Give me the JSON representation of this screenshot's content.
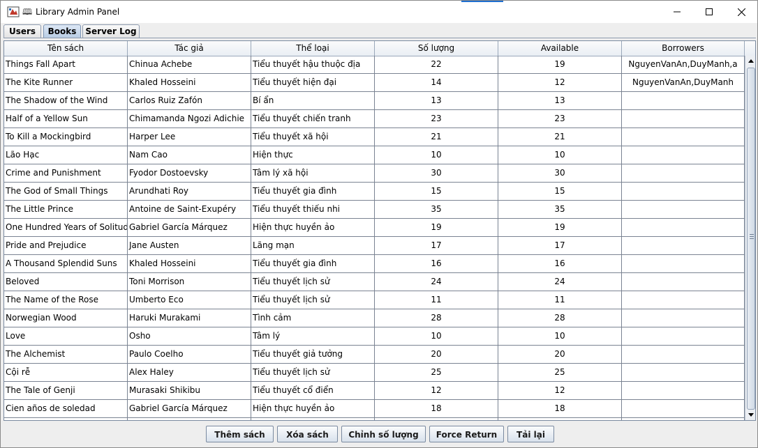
{
  "window": {
    "title": "Library Admin Panel",
    "accent_color": "#1f6fd0"
  },
  "icons": {
    "app": "app-icon",
    "minimize": "minimize-icon",
    "maximize": "maximize-icon",
    "close": "close-icon"
  },
  "tabs": [
    {
      "label": "Users"
    },
    {
      "label": "Books"
    },
    {
      "label": "Server Log"
    }
  ],
  "active_tab": "Books",
  "table": {
    "columns": [
      "Tên sách",
      "Tác giả",
      "Thể loại",
      "Số lượng",
      "Available",
      "Borrowers"
    ],
    "rows": [
      [
        "Things Fall Apart",
        "Chinua Achebe",
        "Tiểu thuyết hậu thuộc địa",
        "22",
        "19",
        "NguyenVanAn,DuyManh,a"
      ],
      [
        "The Kite Runner",
        "Khaled Hosseini",
        "Tiểu thuyết hiện đại",
        "14",
        "12",
        "NguyenVanAn,DuyManh"
      ],
      [
        "The Shadow of the Wind",
        "Carlos Ruiz Zafón",
        "Bí ẩn",
        "13",
        "13",
        ""
      ],
      [
        "Half of a Yellow Sun",
        "Chimamanda Ngozi Adichie",
        "Tiểu thuyết chiến tranh",
        "23",
        "23",
        ""
      ],
      [
        "To Kill a Mockingbird",
        "Harper Lee",
        "Tiểu thuyết xã hội",
        "21",
        "21",
        ""
      ],
      [
        "Lão Hạc",
        "Nam Cao",
        "Hiện thực",
        "10",
        "10",
        ""
      ],
      [
        "Crime and Punishment",
        "Fyodor Dostoevsky",
        "Tâm lý xã hội",
        "30",
        "30",
        ""
      ],
      [
        "The God of Small Things",
        "Arundhati Roy",
        "Tiểu thuyết gia đình",
        "15",
        "15",
        ""
      ],
      [
        "The Little Prince",
        "Antoine de Saint-Exupéry",
        "Tiểu thuyết thiếu nhi",
        "35",
        "35",
        ""
      ],
      [
        "One Hundred Years of Solitude",
        "Gabriel García Márquez",
        "Hiện thực huyền ảo",
        "19",
        "19",
        ""
      ],
      [
        "Pride and Prejudice",
        "Jane Austen",
        "Lãng mạn",
        "17",
        "17",
        ""
      ],
      [
        "A Thousand Splendid Suns",
        "Khaled Hosseini",
        "Tiểu thuyết gia đình",
        "16",
        "16",
        ""
      ],
      [
        "Beloved",
        "Toni Morrison",
        "Tiểu thuyết lịch sử",
        "24",
        "24",
        ""
      ],
      [
        "The Name of the Rose",
        "Umberto Eco",
        "Tiểu thuyết lịch sử",
        "11",
        "11",
        ""
      ],
      [
        "Norwegian Wood",
        "Haruki Murakami",
        "Tình cảm",
        "28",
        "28",
        ""
      ],
      [
        "Love",
        "Osho",
        "Tâm lý",
        "10",
        "10",
        ""
      ],
      [
        "The Alchemist",
        "Paulo Coelho",
        "Tiểu thuyết giả tưởng",
        "20",
        "20",
        ""
      ],
      [
        "Cội rễ",
        "Alex Haley",
        "Tiểu thuyết lịch sử",
        "25",
        "25",
        ""
      ],
      [
        "The Tale of Genji",
        "Murasaki Shikibu",
        "Tiểu thuyết cổ điển",
        "12",
        "12",
        ""
      ],
      [
        "Cien años de soledad",
        "Gabriel García Márquez",
        "Hiện thực huyền ảo",
        "18",
        "18",
        ""
      ]
    ]
  },
  "buttons": {
    "add": "Thêm sách",
    "delete": "Xóa sách",
    "edit_quantity": "Chỉnh số lượng",
    "force_return": "Force Return",
    "reload": "Tải lại"
  }
}
